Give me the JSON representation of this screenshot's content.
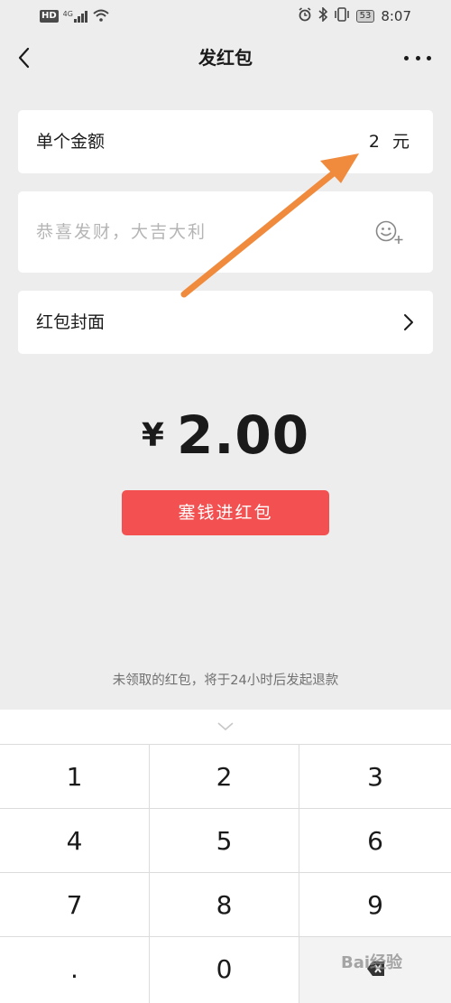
{
  "status_bar": {
    "network_badge": "HD",
    "signal": "4G",
    "battery": "53",
    "time": "8:07"
  },
  "navbar": {
    "title": "发红包"
  },
  "form": {
    "amount_label": "单个金额",
    "amount_value": "2 元",
    "message_placeholder": "恭喜发财，大吉大利",
    "cover_label": "红包封面"
  },
  "total": {
    "currency": "¥",
    "amount": "2.00"
  },
  "send_button_label": "塞钱进红包",
  "refund_note": "未领取的红包，将于24小时后发起退款",
  "keypad": {
    "keys": [
      "1",
      "2",
      "3",
      "4",
      "5",
      "6",
      "7",
      "8",
      "9",
      ".",
      "0"
    ]
  },
  "watermark": "Bai经验",
  "colors": {
    "background": "#ededed",
    "button_red": "#f35151",
    "annotation_arrow": "#f08a3c"
  }
}
